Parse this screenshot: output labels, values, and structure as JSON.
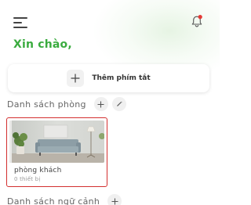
{
  "header": {
    "menu_icon": "hamburger-menu-icon",
    "notification_icon": "bell-icon",
    "notification_dot_color": "#e53935"
  },
  "greeting": {
    "text": "Xin chào,",
    "color": "#3aab3f"
  },
  "shortcut": {
    "label": "Thêm phím tắt",
    "icon": "plus-icon"
  },
  "rooms_section": {
    "title": "Danh sách phòng",
    "add_icon": "plus-icon",
    "edit_icon": "pencil-icon",
    "rooms": [
      {
        "name": "phòng khách",
        "device_count": "0 thiết bị",
        "selected": true
      }
    ]
  },
  "scenes_section": {
    "title": "Danh sách ngữ cảnh",
    "add_icon": "plus-icon"
  }
}
